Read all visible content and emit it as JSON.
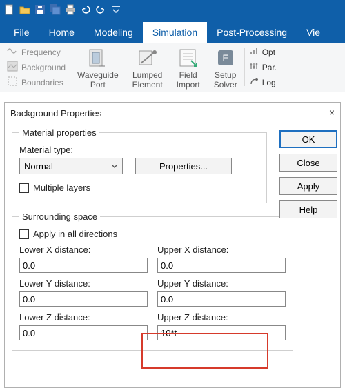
{
  "qa_icons": [
    "new-file-icon",
    "open-folder-icon",
    "save-icon",
    "save-all-icon",
    "print-icon",
    "undo-icon",
    "redo-icon",
    "down-caret-icon"
  ],
  "ribbon": {
    "tabs": [
      "File",
      "Home",
      "Modeling",
      "Simulation",
      "Post-Processing",
      "Vie"
    ],
    "active_index": 3,
    "small_items": [
      {
        "icon": "frequency-icon",
        "label": "Frequency"
      },
      {
        "icon": "background-icon",
        "label": "Background"
      },
      {
        "icon": "boundaries-icon",
        "label": "Boundaries"
      }
    ],
    "large_items": [
      {
        "icon": "waveguide-port-icon",
        "line1": "Waveguide",
        "line2": "Port"
      },
      {
        "icon": "lumped-element-icon",
        "line1": "Lumped",
        "line2": "Element"
      },
      {
        "icon": "field-import-icon",
        "line1": "Field",
        "line2": "Import"
      },
      {
        "icon": "setup-solver-icon",
        "line1": "Setup",
        "line2": "Solver"
      }
    ],
    "right_items": [
      {
        "icon": "opt-icon",
        "label": "Opt"
      },
      {
        "icon": "par-icon",
        "label": "Par."
      },
      {
        "icon": "log-icon",
        "label": "Log"
      }
    ]
  },
  "dialog": {
    "title": "Background Properties",
    "close_symbol": "×",
    "material_group": "Material properties",
    "material_type_label": "Material type:",
    "material_type_value": "Normal",
    "properties_btn": "Properties...",
    "multiple_layers": "Multiple layers",
    "surrounding_group": "Surrounding space",
    "apply_all": "Apply in all directions",
    "fields": {
      "lx": {
        "label": "Lower X distance:",
        "value": "0.0"
      },
      "ux": {
        "label": "Upper X distance:",
        "value": "0.0"
      },
      "ly": {
        "label": "Lower Y distance:",
        "value": "0.0"
      },
      "uy": {
        "label": "Upper Y distance:",
        "value": "0.0"
      },
      "lz": {
        "label": "Lower Z distance:",
        "value": "0.0"
      },
      "uz": {
        "label": "Upper Z distance:",
        "value": "10*t"
      }
    },
    "buttons": {
      "ok": "OK",
      "close": "Close",
      "apply": "Apply",
      "help": "Help"
    }
  }
}
